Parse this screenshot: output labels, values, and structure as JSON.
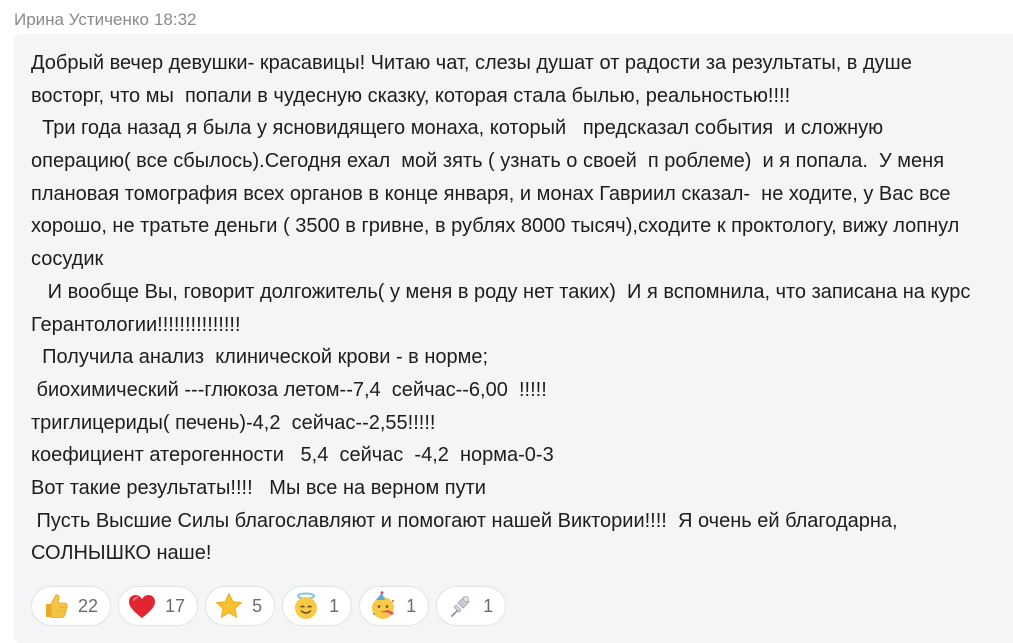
{
  "message": {
    "author": "Ирина Устиченко",
    "time": "18:32",
    "lines": [
      "Добрый вечер девушки- красавицы! Читаю чат, слезы душат от радости за результаты, в душе",
      "восторг, что мы  попали в чудесную сказку, которая стала былью, реальностью!!!!",
      "  Три года назад я была у ясновидящего монаха, который   предсказал события  и сложную",
      "операцию( все сбылось).Сегодня ехал  мой зять ( узнать о своей  п роблеме)  и я попала.  У меня",
      "плановая томография всех органов в конце января, и монах Гавриил сказал-  не ходите, у Вас все",
      "хорошо, не тратьте деньги ( 3500 в гривне, в рублях 8000 тысяч),сходите к проктологу, вижу лопнул",
      "сосудик",
      "   И вообще Вы, говорит долгожитель( у меня в роду нет таких)  И я вспомнила, что записана на курс",
      "Герантологии!!!!!!!!!!!!!!!",
      "  Получила анализ  клинической крови - в норме;",
      " биохимический ---глюкоза летом--7,4  сейчас--6,00  !!!!!",
      "триглицериды( печень)-4,2  сейчас--2,55!!!!!",
      "коефициент атерогенности   5,4  сейчас  -4,2  норма-0-3",
      "Вот такие результаты!!!!   Мы все на верном пути",
      " Пусть Высшие Силы благославляют и помогают нашей Виктории!!!!  Я очень ей благодарна,",
      "СОЛНЫШКО наше!"
    ]
  },
  "reactions": [
    {
      "icon": "thumbs-up-icon",
      "count": "22"
    },
    {
      "icon": "heart-icon",
      "count": "17"
    },
    {
      "icon": "star-icon",
      "count": "5"
    },
    {
      "icon": "smiling-face-with-halo-icon",
      "count": "1"
    },
    {
      "icon": "partying-face-icon",
      "count": "1"
    },
    {
      "icon": "pushpin-icon",
      "count": "1"
    }
  ],
  "colors": {
    "author_text": "#8a8a8a",
    "bubble_background": "#f4f5f7",
    "body_text": "#1d1d1d",
    "reaction_count": "#6c6c6c",
    "heart": "#e0262e",
    "thumb": "#f6c443",
    "star": "#f9c12e"
  }
}
